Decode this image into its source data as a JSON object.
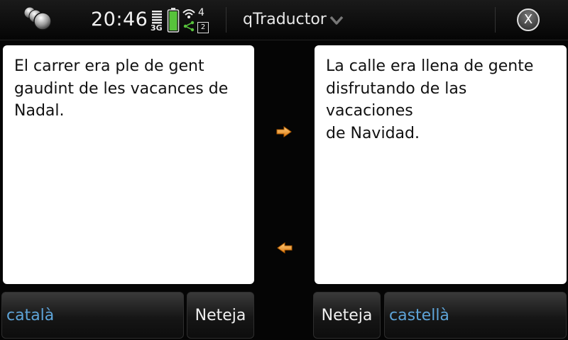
{
  "statusbar": {
    "time": "20:46",
    "network_label": "3G",
    "open_apps_count": "4",
    "notification_count": "2"
  },
  "app": {
    "title": "qTraductor",
    "close_label": "X"
  },
  "source": {
    "language": "català",
    "text": "El carrer era ple de gent\ngaudint de les vacances de\nNadal.",
    "clear_label": "Neteja"
  },
  "target": {
    "language": "castellà",
    "text": "La calle era llena de gente\ndisfrutando de las vacaciones\nde Navidad.",
    "clear_label": "Neteja"
  },
  "colors": {
    "accent_arrow": "#f0a030",
    "language_text": "#5ea4d8",
    "battery_green": "#57c33b"
  },
  "icons": {
    "task_switcher": "task-switcher-icon",
    "network": "signal-strength-icon",
    "battery": "battery-icon",
    "wifi": "wifi-icon",
    "title_menu": "chevron-down-icon",
    "close": "close-icon",
    "translate_forward": "arrow-right-icon",
    "translate_back": "arrow-left-icon"
  }
}
